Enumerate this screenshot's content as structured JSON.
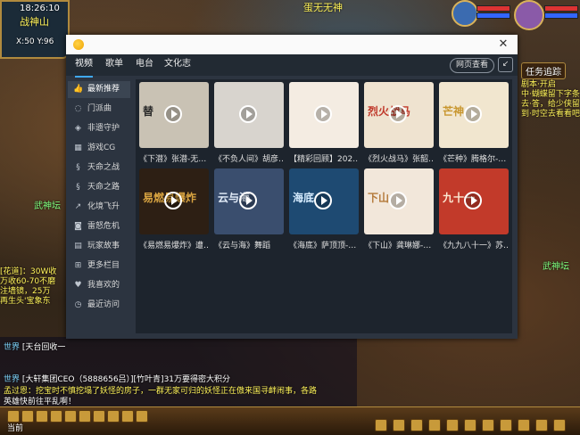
{
  "window": {
    "tabs": [
      {
        "label": "视频",
        "active": true
      },
      {
        "label": "歌单",
        "active": false
      },
      {
        "label": "电台",
        "active": false
      },
      {
        "label": "文化志",
        "active": false
      }
    ],
    "web_button": "网页查看",
    "close_symbol": "✕",
    "minimize_symbol": "↙"
  },
  "sidebar": {
    "items": [
      {
        "label": "最新推荐",
        "icon": "thumbs-up-icon",
        "glyph": "👍",
        "active": true
      },
      {
        "label": "门派曲",
        "icon": "circle-dash-icon",
        "glyph": "◌",
        "active": false
      },
      {
        "label": "非遗守护",
        "icon": "shield-icon",
        "glyph": "◈",
        "active": false
      },
      {
        "label": "游戏CG",
        "icon": "film-icon",
        "glyph": "▦",
        "active": false
      },
      {
        "label": "天命之战",
        "icon": "swirl-icon",
        "glyph": "§",
        "active": false
      },
      {
        "label": "天命之路",
        "icon": "swirl-icon",
        "glyph": "§",
        "active": false
      },
      {
        "label": "化境飞升",
        "icon": "arrow-up-icon",
        "glyph": "↗",
        "active": false
      },
      {
        "label": "雷怒危机",
        "icon": "camera-icon",
        "glyph": "◙",
        "active": false
      },
      {
        "label": "玩家故事",
        "icon": "book-icon",
        "glyph": "▤",
        "active": false
      },
      {
        "label": "更多栏目",
        "icon": "grid-icon",
        "glyph": "⊞",
        "active": false
      },
      {
        "label": "我喜欢的",
        "icon": "heart-icon",
        "glyph": "♥",
        "active": false
      },
      {
        "label": "最近访问",
        "icon": "clock-icon",
        "glyph": "◷",
        "active": false
      }
    ]
  },
  "videos": [
    {
      "title": "《下潜》张潜-无…",
      "thumb_text": "替",
      "bg": "#c9c2b4",
      "fg": "#2a2a2a"
    },
    {
      "title": "《不负人间》胡彦…",
      "thumb_text": "",
      "bg": "#d8d4ce",
      "fg": "#333"
    },
    {
      "title": "【精彩回顾】202…",
      "thumb_text": "",
      "bg": "#f4ece2",
      "fg": "#b23a2a"
    },
    {
      "title": "《烈火战马》张韶…",
      "thumb_text": "烈火战马",
      "bg": "#efe3d0",
      "fg": "#c0392b"
    },
    {
      "title": "《芒种》腾格尔-…",
      "thumb_text": "芒神",
      "bg": "#f1e6cf",
      "fg": "#c8962e"
    },
    {
      "title": "《易燃易爆炸》遭…",
      "thumb_text": "易燃易爆炸",
      "bg": "#2d1f14",
      "fg": "#d9a441"
    },
    {
      "title": "《云与海》舞蹈",
      "thumb_text": "云与海",
      "bg": "#3a4e6e",
      "fg": "#e4eefa"
    },
    {
      "title": "《海底》萨顶顶-…",
      "thumb_text": "海底",
      "bg": "#1e4a72",
      "fg": "#d6ecff"
    },
    {
      "title": "《下山》龚琳娜-…",
      "thumb_text": "下山",
      "bg": "#f2e7da",
      "fg": "#b47a3a"
    },
    {
      "title": "《九九八十一》苏…",
      "thumb_text": "九十一",
      "bg": "#c23a2a",
      "fg": "#fbe8d2"
    }
  ],
  "hud": {
    "time": "18:26:10",
    "location": "战神山",
    "coords": "X:50 Y:96",
    "top_banner": "蛋无无神",
    "task_button": "任务追踪",
    "chat_lines": [
      {
        "prefix": "世界",
        "text": "[天台回收一",
        "color": "white"
      },
      {
        "prefix": "世界",
        "text": "[大轩集团CEO（5888656吕）][竹叶青]31万要得密大积分",
        "color": "white"
      },
      {
        "prefix": "",
        "text": "孟过恩：挖宝时不慎挖塌了妖怪的房子，一群无家可归的妖怪正在傲来国寻衅闹事，各路",
        "color": "yellow"
      },
      {
        "prefix": "",
        "text": "英雄快前往平乱啊！",
        "color": "white"
      }
    ],
    "left_notes": [
      "[花道]：30W收",
      "万收60-70不磨",
      "注墙镜，25万",
      "再生头'宝象东"
    ],
    "right_notes": [
      "剧本·开启",
      "中·蝴蝶留下字条",
      "去·答，给少侠留了好",
      "到·时空去看看吧"
    ],
    "left_name": "武神坛",
    "right_name": "武神坛",
    "bottom_label": "当前"
  }
}
